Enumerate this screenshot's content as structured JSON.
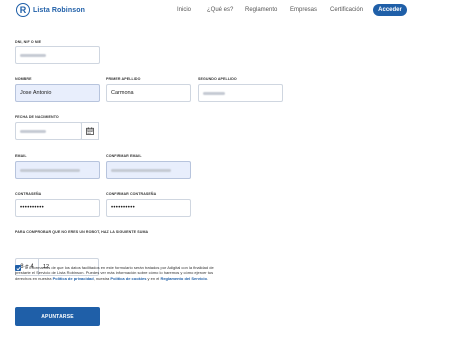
{
  "brand": {
    "name": "Lista Robinson",
    "logo_letter": "R"
  },
  "nav": {
    "links": [
      "Inicio",
      "¿Qué es?",
      "Reglamento",
      "Empresas",
      "Certificación"
    ],
    "button": "Acceder"
  },
  "form": {
    "dni_label": "DNI, NIF o NIE",
    "nombre_label": "Nombre",
    "nombre_value": "Jose Antonio",
    "apellido1_label": "Primer apellido",
    "apellido1_value": "Carmona",
    "apellido2_label": "Segundo apellido",
    "fecha_label": "Fecha de nacimiento",
    "email_label": "Email",
    "confirm_email_label": "Confirmar email",
    "password_label": "Contraseña",
    "password_value": "••••••••••",
    "confirm_password_label": "Confirmar contraseña",
    "confirm_password_value": "••••••••••",
    "captcha_label": "Para comprobar que no eres un robot, haz la siguiente suma",
    "captcha_question": "8 + 4",
    "captcha_answer": "12",
    "consent_text_1": "Te informamos de que los datos facilitados en este formulario serán tratados por Adigital con la finalidad de prestarte el Servicio de Lista Robinson. Puedes ver más información sobre cómo lo haremos y cómo ejercer tus derechos en nuestra ",
    "consent_link_privacy": "Política de privacidad",
    "consent_text_2": ", nuestra ",
    "consent_link_cookies": "Política de cookies",
    "consent_text_3": " y en el ",
    "consent_link_reglamento": "Reglamento del Servicio",
    "consent_text_4": ".",
    "consent_checked": true,
    "submit_label": "Apuntarse"
  },
  "colors": {
    "accent": "#1f5fa8",
    "autofill": "#e8eefc"
  },
  "icons": {
    "calendar": "calendar-icon",
    "check": "check-icon"
  }
}
